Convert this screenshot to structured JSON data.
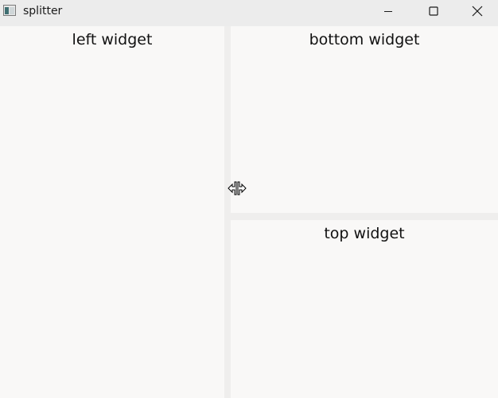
{
  "window": {
    "title": "splitter",
    "icon": "app-window-icon",
    "controls": {
      "minimize_icon": "minimize-icon",
      "maximize_icon": "maximize-icon",
      "close_icon": "close-icon"
    }
  },
  "panes": {
    "left": {
      "label": "left widget"
    },
    "bottom": {
      "label": "bottom widget"
    },
    "top": {
      "label": "top widget"
    }
  },
  "cursor": {
    "icon": "split-horizontal-cursor-icon"
  },
  "colors": {
    "pane_background": "#f9f8f7",
    "splitter_handle": "#efeeed",
    "titlebar": "#ececec",
    "text": "#111111"
  }
}
